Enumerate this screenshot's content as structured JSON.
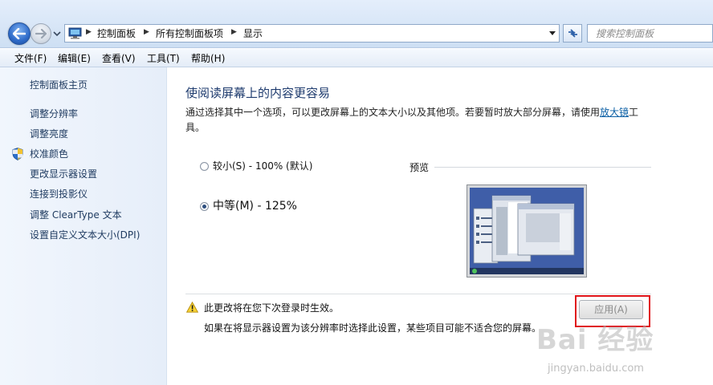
{
  "address_bar": {
    "breadcrumbs": [
      "控制面板",
      "所有控制面板项",
      "显示"
    ],
    "search_placeholder": "搜索控制面板"
  },
  "menu": [
    "文件(F)",
    "编辑(E)",
    "查看(V)",
    "工具(T)",
    "帮助(H)"
  ],
  "sidebar": {
    "home": "控制面板主页",
    "links": [
      "调整分辨率",
      "调整亮度",
      "校准颜色",
      "更改显示器设置",
      "连接到投影仪",
      "调整 ClearType 文本",
      "设置自定义文本大小(DPI)"
    ]
  },
  "main": {
    "title": "使阅读屏幕上的内容更容易",
    "description_before": "通过选择其中一个选项，可以更改屏幕上的文本大小以及其他项。若要暂时放大部分屏幕，请使用",
    "description_link": "放大镜",
    "description_after": "工具。",
    "options": [
      {
        "label": "较小(S) - 100% (默认)",
        "checked": false
      },
      {
        "label": "中等(M) - 125%",
        "checked": true
      }
    ],
    "preview_label": "预览",
    "warning": "此更改将在您下次登录时生效。",
    "warning_detail": "如果在将显示器设置为该分辨率时选择此设置，某些项目可能不适合您的屏幕。",
    "apply_label": "应用(A)"
  },
  "watermark": {
    "brand": "Bai 经验",
    "url": "jingyan.baidu.com"
  },
  "colors": {
    "title_blue": "#1e3b6e",
    "link_blue": "#0b5fa5",
    "highlight_red": "#e0141a"
  }
}
